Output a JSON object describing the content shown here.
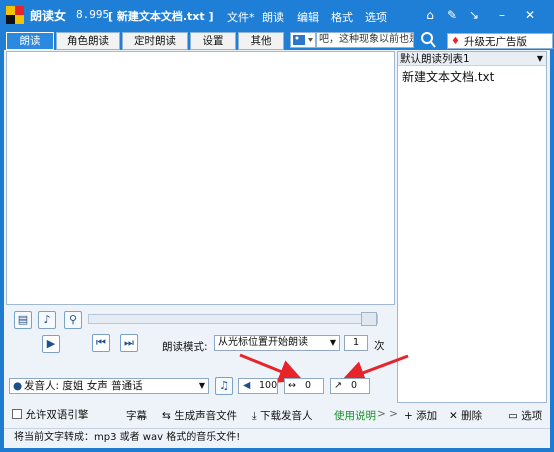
{
  "title_bar": {
    "app_name": "朗读女",
    "version": "8.995",
    "document": "[ 新建文本文档.txt ]",
    "menus": [
      "文件",
      "朗读",
      "编辑",
      "格式",
      "选项"
    ],
    "window_buttons": [
      "home-icon",
      "tools-icon",
      "pin-icon",
      "minimize-icon",
      "close-icon"
    ]
  },
  "tabs": [
    {
      "label": "朗读",
      "active": true
    },
    {
      "label": "角色朗读",
      "active": false
    },
    {
      "label": "定时朗读",
      "active": false
    },
    {
      "label": "设置",
      "active": false
    },
    {
      "label": "其他",
      "active": false
    }
  ],
  "search": {
    "text": "吧，这种现象以前也是有"
  },
  "upgrade_label": "升级无广告版",
  "playlist": {
    "header": "默认朗读列表1",
    "items": [
      "新建文本文档.txt"
    ]
  },
  "controls": {
    "mode_label": "朗读模式:",
    "mode_value": "从光标位置开始朗读",
    "repeat_count": "1",
    "repeat_unit": "次",
    "voice_prefix": "发音人:",
    "voice_value": "度姐 女声 普通话",
    "volume": "100",
    "speed": "0",
    "pitch": "0"
  },
  "bottom": {
    "bilingual": "允许双语引擎",
    "subtitle": "字幕",
    "generate_audio": "生成声音文件",
    "download_voice": "下载发音人",
    "usage": "使用说明",
    "more": "> >",
    "add": "添加",
    "delete": "删除",
    "options": "选项"
  },
  "status_text": "将当前文字转成：mp3 或者 wav 格式的音乐文件!",
  "colors": {
    "title_bar": "#1f7fd6",
    "arrow": "#e8242b",
    "usage_link": "#1a8f2a"
  }
}
